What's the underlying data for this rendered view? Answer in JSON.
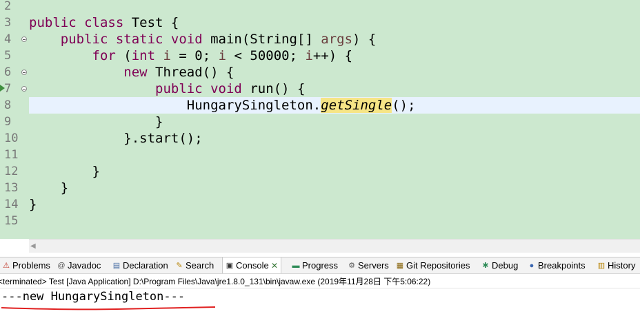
{
  "editor": {
    "lines": [
      {
        "num": "2",
        "fold": false,
        "marker": false,
        "current": false,
        "tokens": []
      },
      {
        "num": "3",
        "fold": false,
        "marker": false,
        "current": false,
        "tokens": [
          {
            "t": "public class",
            "c": "kw"
          },
          {
            "t": " Test {",
            "c": ""
          }
        ]
      },
      {
        "num": "4",
        "fold": true,
        "marker": false,
        "current": false,
        "tokens": [
          {
            "t": "    ",
            "c": ""
          },
          {
            "t": "public static void",
            "c": "kw"
          },
          {
            "t": " main(String[] ",
            "c": ""
          },
          {
            "t": "args",
            "c": "var"
          },
          {
            "t": ") {",
            "c": ""
          }
        ]
      },
      {
        "num": "5",
        "fold": false,
        "marker": false,
        "current": false,
        "tokens": [
          {
            "t": "        ",
            "c": ""
          },
          {
            "t": "for",
            "c": "kw"
          },
          {
            "t": " (",
            "c": ""
          },
          {
            "t": "int",
            "c": "kw"
          },
          {
            "t": " ",
            "c": ""
          },
          {
            "t": "i",
            "c": "var"
          },
          {
            "t": " = 0; ",
            "c": ""
          },
          {
            "t": "i",
            "c": "var"
          },
          {
            "t": " < 50000; ",
            "c": ""
          },
          {
            "t": "i",
            "c": "var"
          },
          {
            "t": "++) {",
            "c": ""
          }
        ]
      },
      {
        "num": "6",
        "fold": true,
        "marker": false,
        "current": false,
        "tokens": [
          {
            "t": "            ",
            "c": ""
          },
          {
            "t": "new",
            "c": "kw"
          },
          {
            "t": " Thread() {",
            "c": ""
          }
        ]
      },
      {
        "num": "7",
        "fold": true,
        "marker": true,
        "current": false,
        "tokens": [
          {
            "t": "                ",
            "c": ""
          },
          {
            "t": "public void",
            "c": "kw"
          },
          {
            "t": " run() {",
            "c": ""
          }
        ]
      },
      {
        "num": "8",
        "fold": false,
        "marker": false,
        "current": true,
        "tokens": [
          {
            "t": "                    HungarySingleton.",
            "c": ""
          },
          {
            "t": "getSingle",
            "c": "static-m"
          },
          {
            "t": "();",
            "c": ""
          }
        ]
      },
      {
        "num": "9",
        "fold": false,
        "marker": false,
        "current": false,
        "tokens": [
          {
            "t": "                }",
            "c": ""
          }
        ]
      },
      {
        "num": "10",
        "fold": false,
        "marker": false,
        "current": false,
        "tokens": [
          {
            "t": "            }.start();",
            "c": ""
          }
        ]
      },
      {
        "num": "11",
        "fold": false,
        "marker": false,
        "current": false,
        "tokens": []
      },
      {
        "num": "12",
        "fold": false,
        "marker": false,
        "current": false,
        "tokens": [
          {
            "t": "        }",
            "c": ""
          }
        ]
      },
      {
        "num": "13",
        "fold": false,
        "marker": false,
        "current": false,
        "tokens": [
          {
            "t": "    }",
            "c": ""
          }
        ]
      },
      {
        "num": "14",
        "fold": false,
        "marker": false,
        "current": false,
        "tokens": [
          {
            "t": "}",
            "c": ""
          }
        ]
      },
      {
        "num": "15",
        "fold": false,
        "marker": false,
        "current": false,
        "tokens": []
      }
    ]
  },
  "tabs": [
    {
      "id": "problems",
      "label": "Problems",
      "icon": "problems-icon",
      "glyph": "⚠",
      "color": "#c0392b",
      "active": false
    },
    {
      "id": "javadoc",
      "label": "Javadoc",
      "icon": "javadoc-icon",
      "glyph": "@",
      "color": "#555555",
      "active": false
    },
    {
      "id": "declaration",
      "label": "Declaration",
      "icon": "declaration-icon",
      "glyph": "▤",
      "color": "#4a6fa5",
      "active": false
    },
    {
      "id": "search",
      "label": "Search",
      "icon": "search-icon",
      "glyph": "✎",
      "color": "#b8860b",
      "active": false
    },
    {
      "id": "console",
      "label": "Console",
      "icon": "console-icon",
      "glyph": "▣",
      "color": "#333333",
      "active": true
    },
    {
      "id": "progress",
      "label": "Progress",
      "icon": "progress-icon",
      "glyph": "▬",
      "color": "#2e8b57",
      "active": false
    },
    {
      "id": "servers",
      "label": "Servers",
      "icon": "servers-icon",
      "glyph": "⚙",
      "color": "#555555",
      "active": false
    },
    {
      "id": "git",
      "label": "Git Repositories",
      "icon": "git-repositories-icon",
      "glyph": "▦",
      "color": "#8b6914",
      "active": false
    },
    {
      "id": "debug",
      "label": "Debug",
      "icon": "debug-icon",
      "glyph": "✱",
      "color": "#2e8b57",
      "active": false
    },
    {
      "id": "breakpoints",
      "label": "Breakpoints",
      "icon": "breakpoints-icon",
      "glyph": "●",
      "color": "#3a66b0",
      "active": false
    },
    {
      "id": "history",
      "label": "History",
      "icon": "history-icon",
      "glyph": "▥",
      "color": "#b8860b",
      "active": false
    }
  ],
  "console": {
    "close_glyph": "✕",
    "status": "<terminated> Test [Java Application] D:\\Program Files\\Java\\jre1.8.0_131\\bin\\javaw.exe (2019年11月28日 下午5:06:22)",
    "output": "---new HungarySingleton---",
    "annotation_color": "#e02020"
  },
  "scroll": {
    "left_arrow": "◀"
  }
}
